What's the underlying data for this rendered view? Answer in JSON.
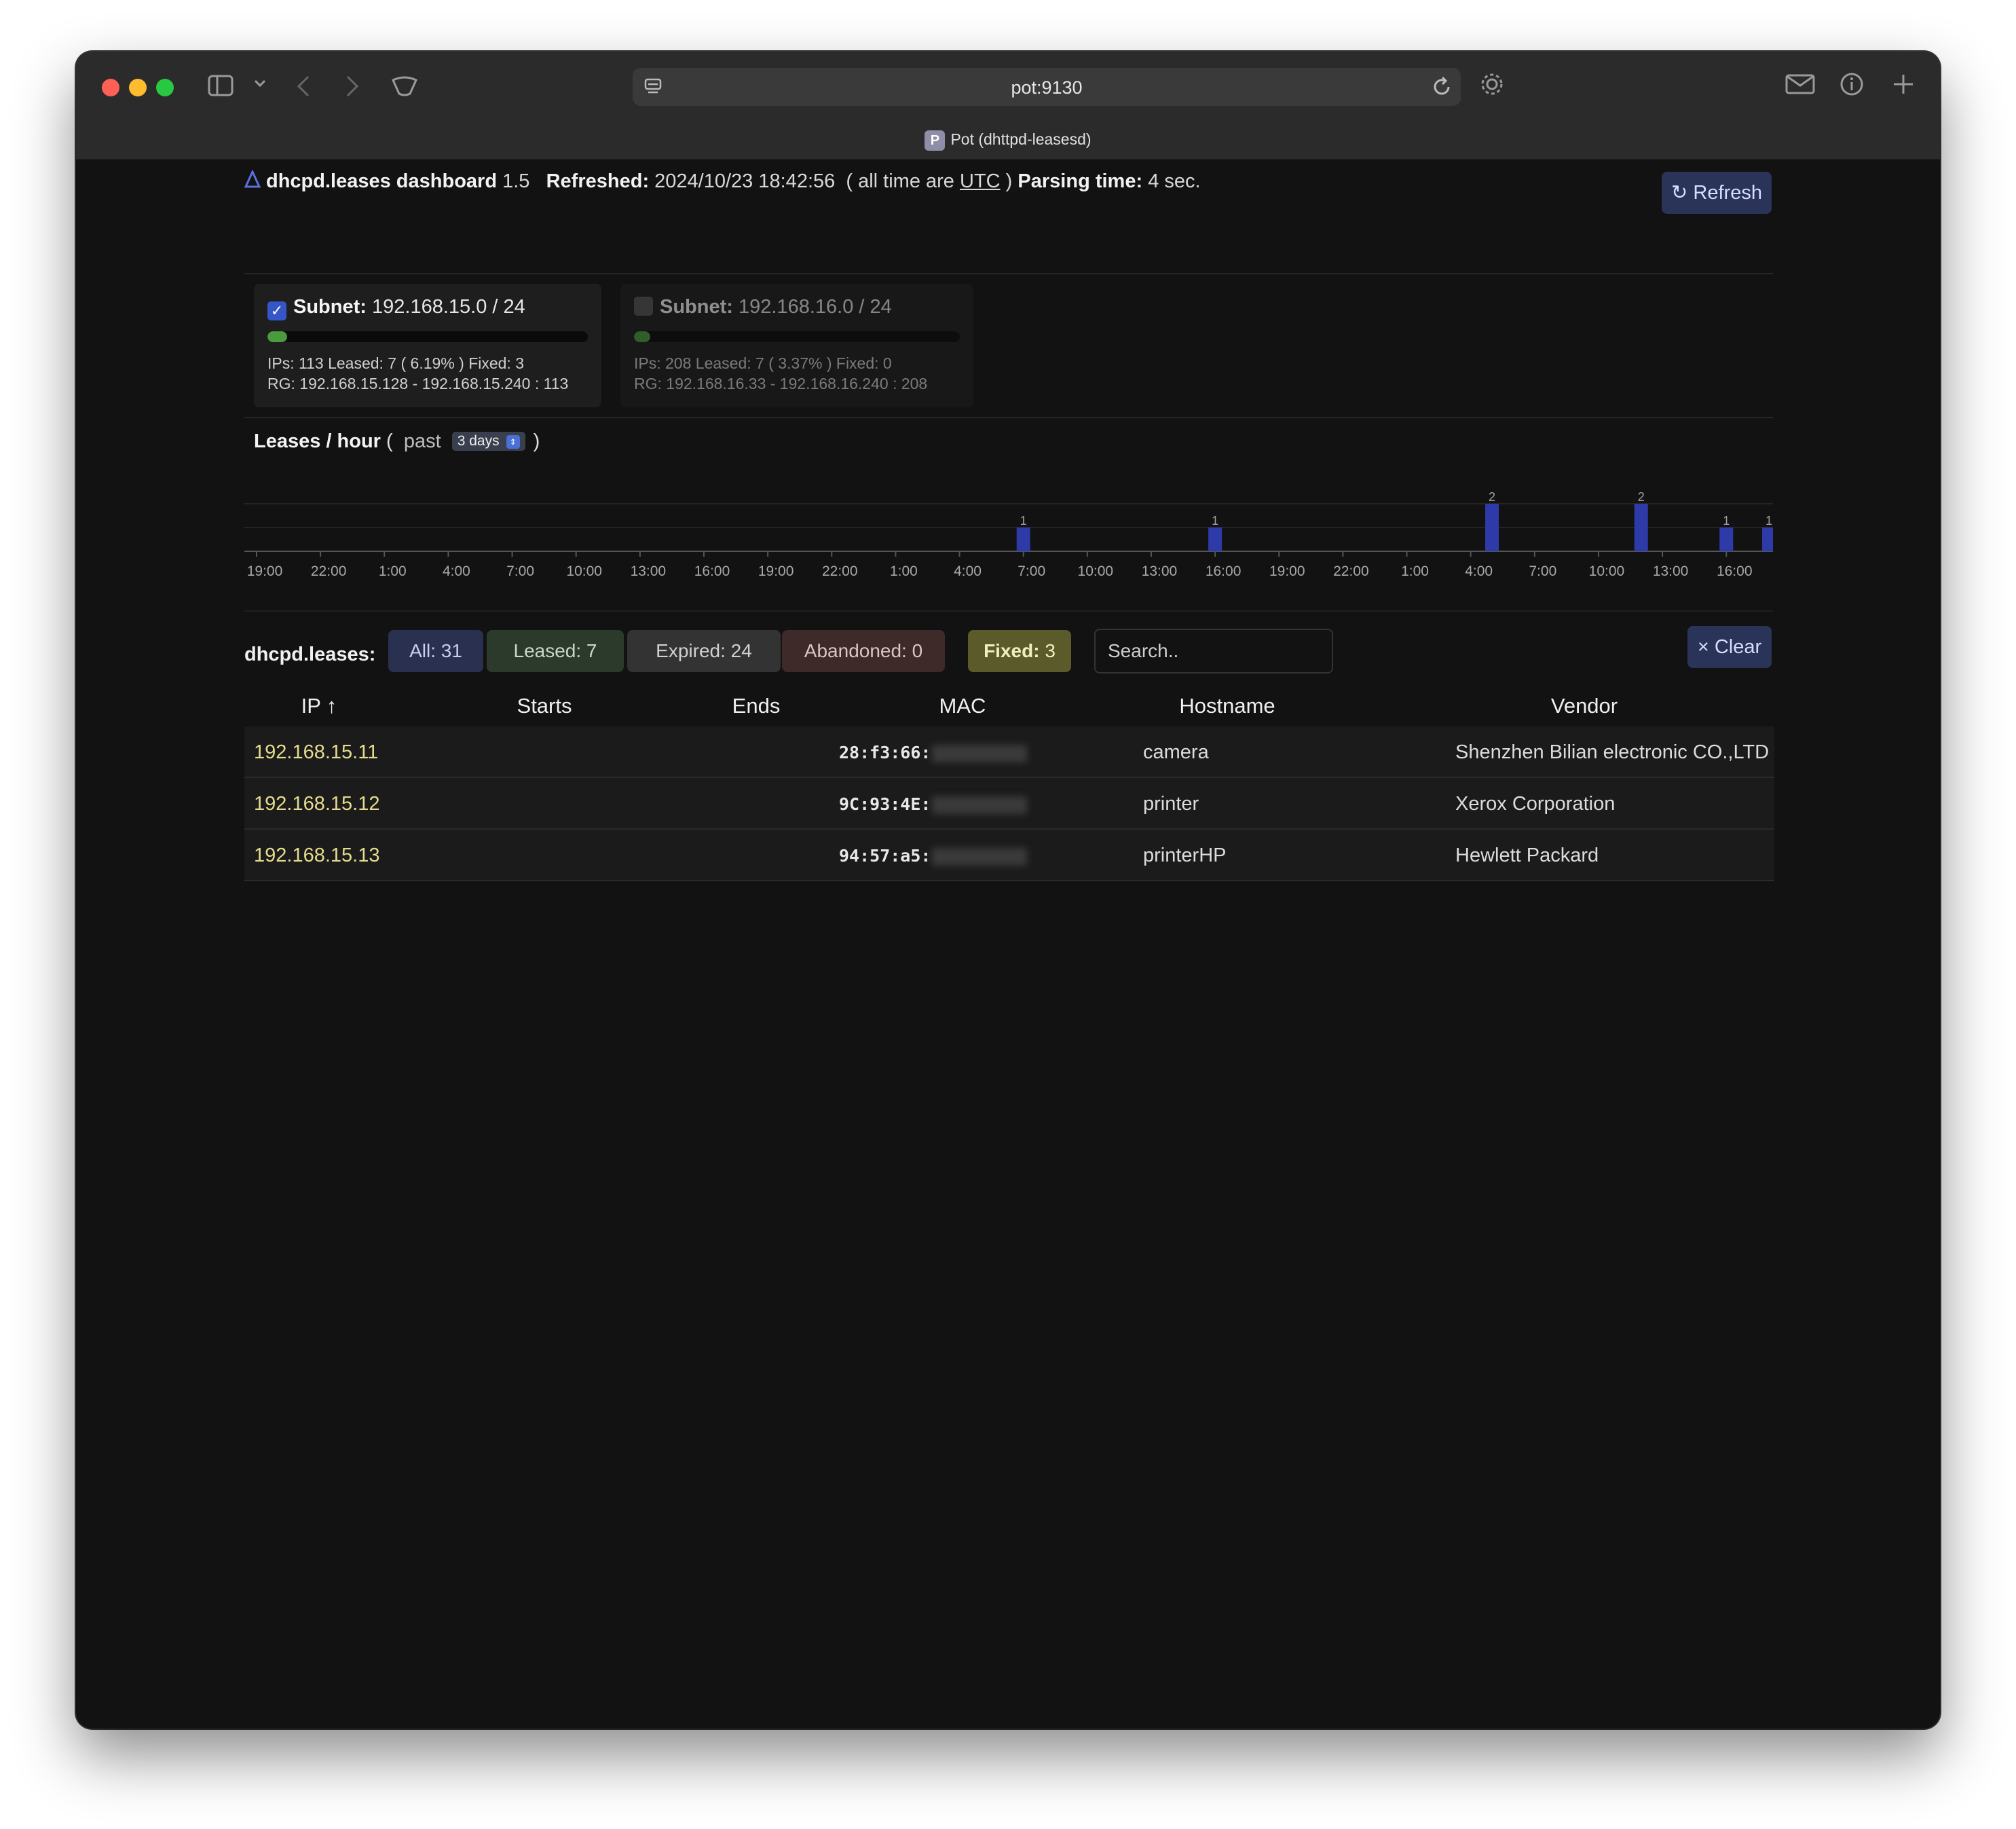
{
  "browser": {
    "url": "pot:9130",
    "tab_title": "Pot (dhttpd-leasesd)",
    "tab_favicon": "P",
    "icons": [
      "sidebar-icon",
      "chevron-down-icon",
      "back-icon",
      "forward-icon",
      "shield-icon",
      "site-info-icon",
      "reload-icon",
      "gear-icon",
      "mail-icon",
      "info-icon",
      "plus-icon"
    ]
  },
  "header": {
    "app_name": "dhcpd.leases dashboard",
    "version": "1.5",
    "refreshed_label": "Refreshed:",
    "refreshed_value": "2024/10/23 18:42:56",
    "tz_prefix": "( all time are",
    "tz_link": "UTC",
    "tz_suffix": ")",
    "parsing_label": "Parsing time:",
    "parsing_value": "4 sec.",
    "refresh_button": "Refresh",
    "refresh_icon": "↻"
  },
  "subnets": [
    {
      "checked": true,
      "label": "Subnet:",
      "value": "192.168.15.0 / 24",
      "usage_fraction": 0.0619,
      "stats": "IPs: 113  Leased: 7 ( 6.19% ) Fixed: 3",
      "range": "RG: 192.168.15.128 - 192.168.15.240 : 113"
    },
    {
      "checked": false,
      "label": "Subnet:",
      "value": "192.168.16.0 / 24",
      "usage_fraction": 0.0337,
      "stats": "IPs: 208  Leased: 7 ( 3.37% ) Fixed: 0",
      "range": "RG: 192.168.16.33 - 192.168.16.240 : 208"
    }
  ],
  "leases_per_hour": {
    "title": "Leases / hour",
    "open_paren": "(",
    "past_label": "past",
    "range_select": "3 days",
    "close_paren": ")"
  },
  "chart_data": {
    "type": "bar",
    "title": "Leases / hour",
    "bar_color": "#2e3aa8",
    "ylim": [
      0,
      2
    ],
    "hours_total": 72,
    "tick_labels": [
      "19:00",
      "22:00",
      "1:00",
      "4:00",
      "7:00",
      "10:00",
      "13:00",
      "16:00",
      "19:00",
      "22:00",
      "1:00",
      "4:00",
      "7:00",
      "10:00",
      "13:00",
      "16:00",
      "19:00",
      "22:00",
      "1:00",
      "4:00",
      "7:00",
      "10:00",
      "13:00",
      "16:00"
    ],
    "bars": [
      {
        "hour_index": 36,
        "value": 1
      },
      {
        "hour_index": 45,
        "value": 1
      },
      {
        "hour_index": 58,
        "value": 2
      },
      {
        "hour_index": 65,
        "value": 2
      },
      {
        "hour_index": 69,
        "value": 1
      },
      {
        "hour_index": 71,
        "value": 1
      }
    ]
  },
  "filters": {
    "label": "dhcpd.leases:",
    "all": "All: 31",
    "leased": "Leased: 7",
    "expired": "Expired: 24",
    "abandoned": "Abandoned: 0",
    "fixed_label": "Fixed:",
    "fixed_count": "3",
    "search_placeholder": "Search..",
    "clear_button": "× Clear"
  },
  "table": {
    "headers": {
      "ip": "IP ↑",
      "starts": "Starts",
      "ends": "Ends",
      "mac": "MAC",
      "hostname": "Hostname",
      "vendor": "Vendor"
    },
    "rows": [
      {
        "ip": "192.168.15.11",
        "starts": "",
        "ends": "",
        "mac": "28:f3:66:",
        "hostname": "camera",
        "vendor": "Shenzhen Bilian electronic CO.,LTD"
      },
      {
        "ip": "192.168.15.12",
        "starts": "",
        "ends": "",
        "mac": "9C:93:4E:",
        "hostname": "printer",
        "vendor": "Xerox Corporation"
      },
      {
        "ip": "192.168.15.13",
        "starts": "",
        "ends": "",
        "mac": "94:57:a5:",
        "hostname": "printerHP",
        "vendor": "Hewlett Packard"
      }
    ]
  }
}
